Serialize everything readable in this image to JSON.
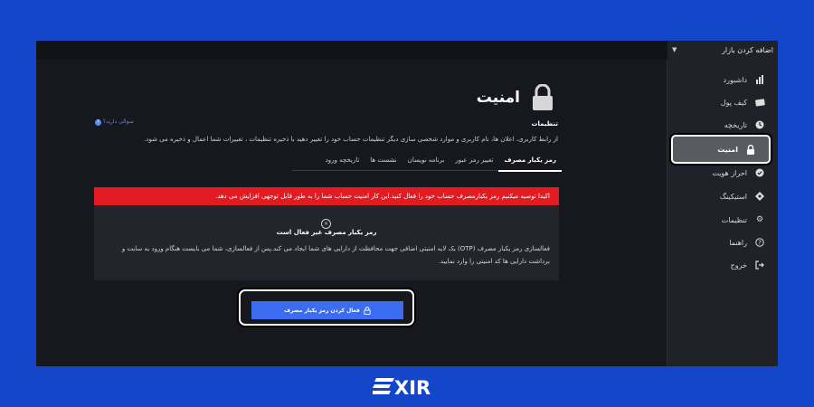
{
  "market": {
    "label": "اضافه کردن بازار"
  },
  "sidebar": {
    "items": [
      {
        "label": "داشبورد",
        "icon": "bar-chart-icon"
      },
      {
        "label": "کیف پول",
        "icon": "wallet-icon"
      },
      {
        "label": "تاریخچه",
        "icon": "clock-icon"
      },
      {
        "label": "امنیت",
        "icon": "lock-icon"
      },
      {
        "label": "احراز هویت",
        "icon": "check-badge-icon"
      },
      {
        "label": "استیکینگ",
        "icon": "staking-icon"
      },
      {
        "label": "تنظیمات",
        "icon": "gear-icon"
      },
      {
        "label": "راهنما",
        "icon": "help-icon"
      },
      {
        "label": "خروج",
        "icon": "logout-icon"
      }
    ]
  },
  "page": {
    "title": "امنیت"
  },
  "settings": {
    "title": "تنظیمات",
    "help": "سوالی دارید؟",
    "desc": "از رابط کاربری، اعلان ها، نام کاربری و موارد شخصی سازی دیگر تنظیمات حساب خود را تغییر دهید با ذخیره تنظیمات ، تغییرات شما اعمال و ذخیره می شود."
  },
  "tabs": [
    "رمز یکبار مصرف",
    "تغییر رمز عبور",
    "برنامه نویسان",
    "نشست ها",
    "تاریخچه ورود"
  ],
  "alert": {
    "text": "اکیدا توصیه میکنیم رمز یکبارمصرف حساب خود را فعال کنید.این کار امنیت حساب شما را به طور قابل توجهی افزایش می دهد."
  },
  "otp": {
    "title": "رمز یکبار مصرف غیر فعال است",
    "desc": "فعالسازی رمز یکبار مصرف (OTP) یک لایه امنیتی اضافی جهت محافظت از دارایی های شما ایجاد می کند.پس از فعالسازی، شما می بایست هنگام ورود به سایت و برداشت دارایی ها کد امنیتی را وارد نمایید."
  },
  "cta": {
    "label": "فعال کردن رمز یکبار مصرف"
  },
  "brand": {
    "name": "EXIR"
  },
  "colors": {
    "background": "#1446c9",
    "accent": "#3a6df0",
    "alert": "#e21b22",
    "panel": "#17181d"
  }
}
